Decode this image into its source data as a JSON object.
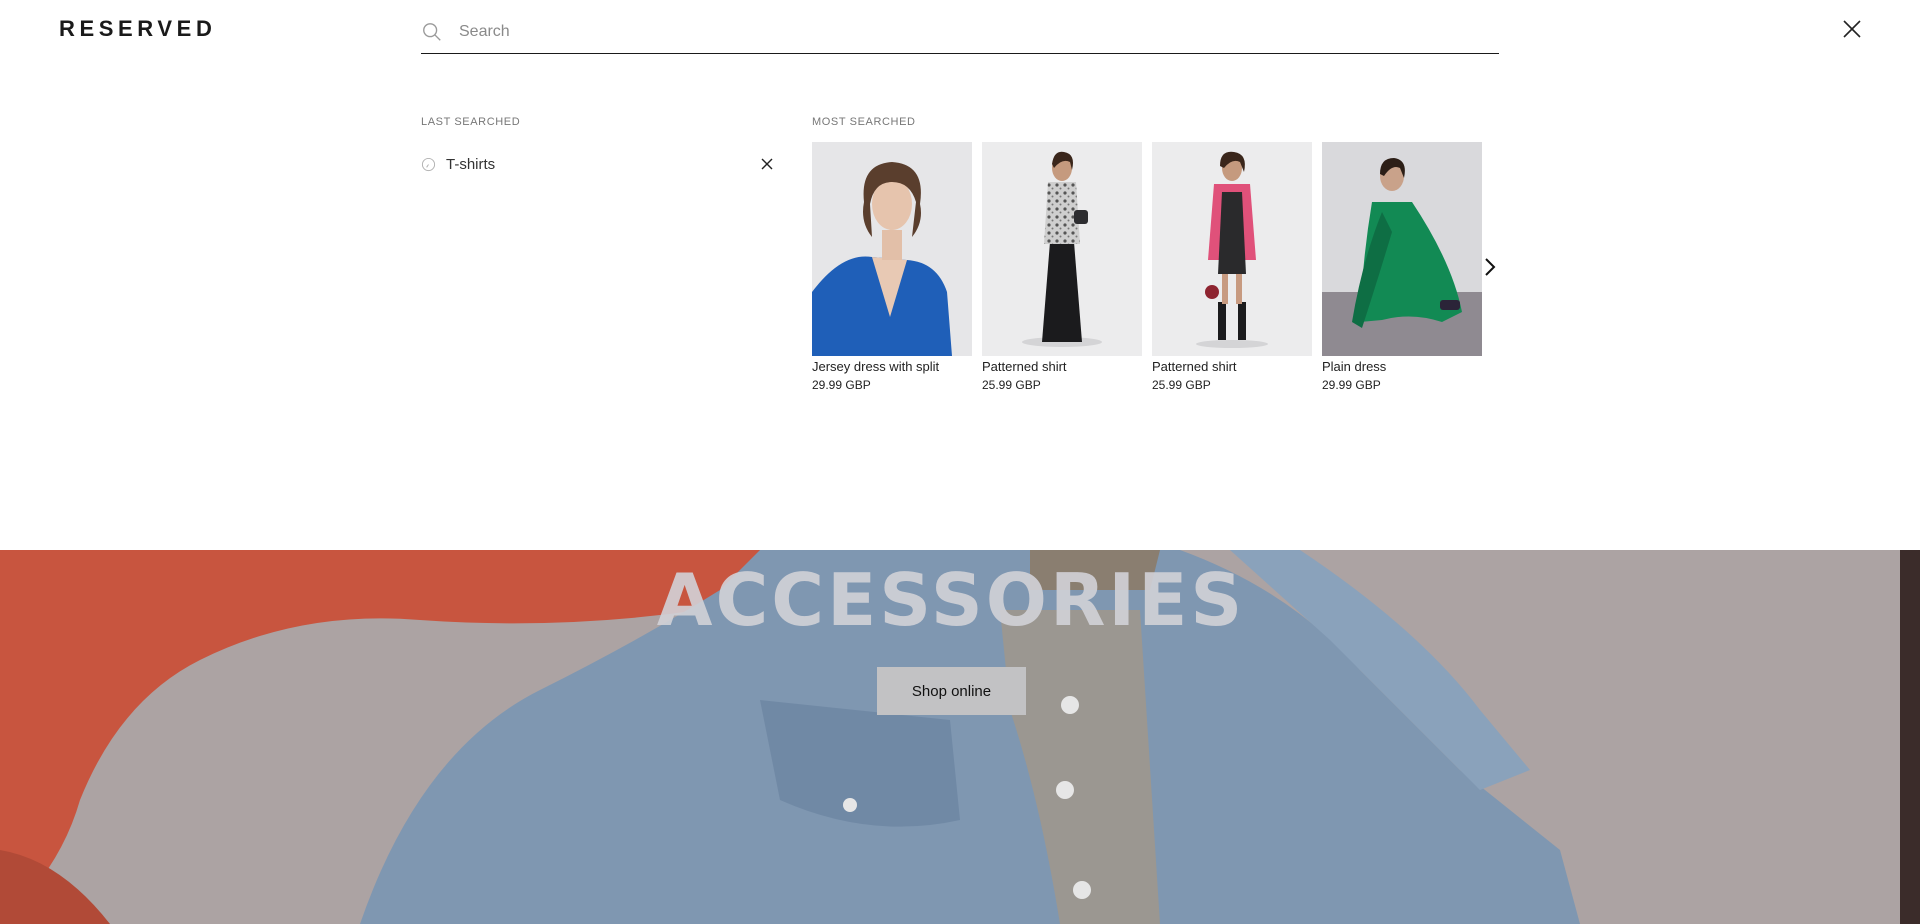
{
  "header": {
    "logo": "RESERVED",
    "search": {
      "placeholder": "Search",
      "value": ""
    }
  },
  "last_searched": {
    "title": "LAST SEARCHED",
    "items": [
      {
        "label": "T-shirts"
      }
    ]
  },
  "most_searched": {
    "title": "MOST SEARCHED",
    "products": [
      {
        "name": "Jersey dress with split",
        "price": "29.99 GBP"
      },
      {
        "name": "Patterned shirt",
        "price": "25.99 GBP"
      },
      {
        "name": "Patterned shirt",
        "price": "25.99 GBP"
      },
      {
        "name": "Plain dress",
        "price": "29.99 GBP"
      }
    ]
  },
  "hero": {
    "title": "ACCESSORIES",
    "button_label": "Shop online"
  },
  "colors": {
    "text": "#222222",
    "hero_bg": "#a99f9d",
    "button_bg": "#c2c2c4"
  },
  "icons": [
    "search-icon",
    "close-icon",
    "clock-icon",
    "remove-icon",
    "chevron-right-icon"
  ]
}
